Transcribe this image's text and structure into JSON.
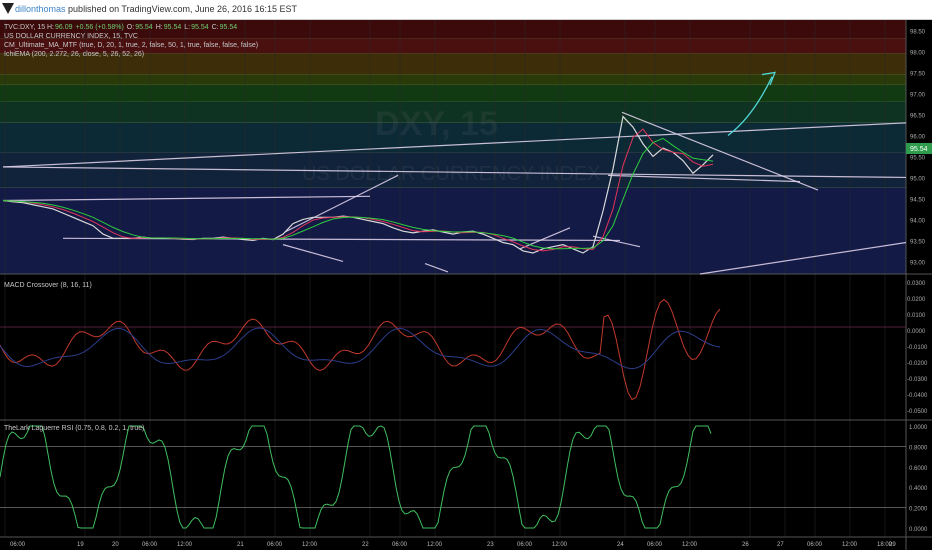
{
  "header": {
    "author": "dillonthomas",
    "published_text": "published on TradingView.com, June 26, 2016 16:15 EST",
    "symbol_line": "TVC:DXY, 15",
    "ohlc": [
      {
        "key": "H:",
        "value": "96.09",
        "color": "#2e7d32"
      },
      {
        "key": "",
        "value": "+0.56 (+0.58%)",
        "color": "#2e7d32"
      },
      {
        "key": "O:",
        "value": "95.54",
        "color": "#2e7d32"
      },
      {
        "key": "H:",
        "value": "95.54",
        "color": "#2e7d32"
      },
      {
        "key": "L:",
        "value": "95.54",
        "color": "#2e7d32"
      },
      {
        "key": "C:",
        "value": "95.54",
        "color": "#2e7d32"
      }
    ]
  },
  "main_pane": {
    "title": "US DOLLAR CURRENCY INDEX, 15, TVC",
    "indicator_1": "CM_Ultimate_MA_MTF (true, D, 20, 1, true, 2, false, 50, 1, true, false, false, false)",
    "indicator_2": "IchiEMA (200, 2.272, 26, close, 5, 26, 52, 26)",
    "watermark_symbol": "DXY, 15",
    "watermark_name": "US DOLLAR CURRENCY INDEX",
    "price_ticks": [
      "98.50",
      "98.00",
      "97.50",
      "97.00",
      "96.50",
      "96.00",
      "95.50",
      "95.00",
      "94.50",
      "94.00",
      "93.50",
      "93.00"
    ],
    "last_price": "95.54"
  },
  "macd_pane": {
    "title": "MACD Crossover (8, 16, 11)",
    "ticks": [
      "0.0300",
      "0.0200",
      "0.0100",
      "0.0000",
      "-0.0100",
      "-0.0200",
      "-0.0300",
      "-0.0400",
      "-0.0500"
    ]
  },
  "rsi_pane": {
    "title": "TheLark Laguerre RSI (0.75, 0.8, 0.2, 1, true)",
    "ticks": [
      "1.0000",
      "0.8000",
      "0.6000",
      "0.4000",
      "0.2000",
      "0.0000"
    ]
  },
  "time_axis": {
    "labels": [
      "06:00",
      "19",
      "20",
      "06:00",
      "12:00",
      "21",
      "06:00",
      "12:00",
      "22",
      "06:00",
      "12:00",
      "23",
      "06:00",
      "12:00",
      "24",
      "06:00",
      "12:00",
      "26",
      "27",
      "06:00",
      "12:00",
      "18:00",
      "29"
    ]
  },
  "chart_data": {
    "type": "line",
    "title": "US DOLLAR CURRENCY INDEX, 15, TVC",
    "xlabel": "",
    "ylabel": "",
    "ylim": [
      92.7,
      98.75
    ],
    "grid": true,
    "x": [
      0,
      10,
      20,
      30,
      40,
      50,
      60,
      70,
      80,
      90,
      100,
      110,
      120,
      130,
      140,
      150,
      160,
      170,
      180,
      190,
      200,
      210,
      220,
      230,
      240,
      250,
      260,
      270,
      280,
      290,
      300,
      310,
      320,
      330,
      340,
      350,
      360,
      370,
      380,
      390,
      400,
      410,
      420,
      430,
      440,
      450,
      460,
      470,
      480,
      490,
      500,
      510,
      520,
      530,
      540,
      550,
      560,
      570,
      580,
      590,
      600,
      610,
      620,
      630,
      640,
      650,
      660,
      670,
      680,
      690,
      700,
      710
    ],
    "series": [
      {
        "values": [
          94.45,
          94.42,
          94.4,
          94.35,
          94.3,
          94.25,
          94.15,
          94.05,
          93.95,
          93.85,
          93.65,
          93.55,
          93.55,
          93.55,
          93.58,
          93.55,
          93.55,
          93.55,
          93.53,
          93.52,
          93.55,
          93.55,
          93.58,
          93.55,
          93.52,
          93.5,
          93.55,
          93.52,
          93.65,
          93.9,
          94.0,
          94.05,
          94.05,
          94.05,
          94.08,
          94.05,
          94.0,
          93.95,
          93.9,
          93.8,
          93.72,
          93.68,
          93.72,
          93.75,
          93.7,
          93.65,
          93.7,
          93.72,
          93.65,
          93.55,
          93.45,
          93.4,
          93.25,
          93.2,
          93.3,
          93.35,
          93.4,
          93.3,
          93.2,
          93.35,
          94.2,
          95.2,
          96.45,
          96.2,
          95.8,
          95.5,
          95.7,
          95.6,
          95.4,
          95.1,
          95.3,
          95.54
        ]
      }
    ]
  }
}
